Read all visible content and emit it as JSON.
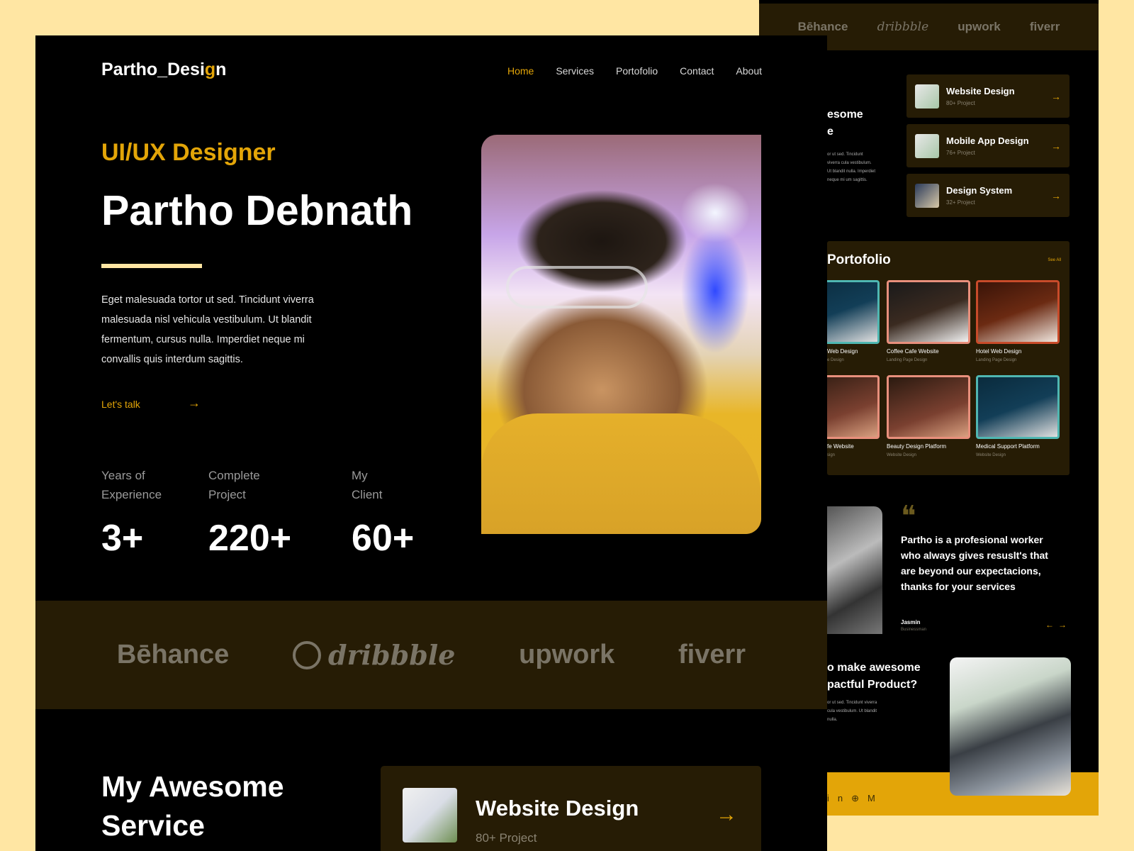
{
  "brand": {
    "name_main": "Partho_Desi",
    "name_dot": "g",
    "name_end": "n"
  },
  "nav": {
    "items": [
      "Home",
      "Services",
      "Portofolio",
      "Contact",
      "About"
    ],
    "active": "Home"
  },
  "hero": {
    "role": "UI/UX Designer",
    "name": "Partho Debnath",
    "description": "Eget malesuada tortor ut sed. Tincidunt viverra malesuada nisl vehicula vestibulum. Ut blandit fermentum, cursus nulla. Imperdiet neque mi convallis quis interdum sagittis.",
    "cta": "Let's talk"
  },
  "stats": [
    {
      "label": "Years of Experience",
      "value": "3+"
    },
    {
      "label": "Complete Project",
      "value": "220+"
    },
    {
      "label": "My Client",
      "value": "60+"
    }
  ],
  "platforms": [
    "Bēhance",
    "dribbble",
    "upwork",
    "fiverr"
  ],
  "services": {
    "heading": "My Awesome Service",
    "featured": {
      "title": "Website Design",
      "count": "80+ Project"
    },
    "list": [
      {
        "title": "Website Design",
        "count": "80+ Project"
      },
      {
        "title": "Mobile App Design",
        "count": "76+ Project"
      },
      {
        "title": "Design System",
        "count": "32+ Project"
      }
    ]
  },
  "back_partial": {
    "heading_fragment": "esome\ne",
    "para_fragment": "or ut sed. Tincidunt viverra cula vestibulum. Ut blandit nulla. Imperdiet neque mi um sagittis."
  },
  "portfolio": {
    "title": "Portofolio",
    "see_all": "See All",
    "items": [
      {
        "name": "Web Design",
        "type": "e Design"
      },
      {
        "name": "Coffee Cafe Website",
        "type": "Landing Page Design"
      },
      {
        "name": "Hotel Web Design",
        "type": "Landing Page Design"
      },
      {
        "name": "fe Website",
        "type": "sign"
      },
      {
        "name": "Beauty Design Platform",
        "type": "Website Design"
      },
      {
        "name": "Medical Support Platform",
        "type": "Website Design"
      }
    ]
  },
  "testimonial": {
    "quote": "Partho is a profesional worker who always gives resuslt's that are beyond our expectacions, thanks for your services",
    "name": "Jasmin",
    "role": "Businessman"
  },
  "cta_section": {
    "heading": "o make awesome\npactful Product?",
    "para": "or ut sed. Tincidunt viverra cula vestibulum. Ut blandit nulla."
  },
  "icons": {
    "arrow": "→",
    "arrow_left": "←",
    "quote": "❝",
    "social": [
      "in",
      "⊕",
      "M"
    ]
  },
  "colors": {
    "accent": "#e3a508",
    "background": "#000000",
    "band": "#261c05",
    "page": "#ffe6a3"
  }
}
